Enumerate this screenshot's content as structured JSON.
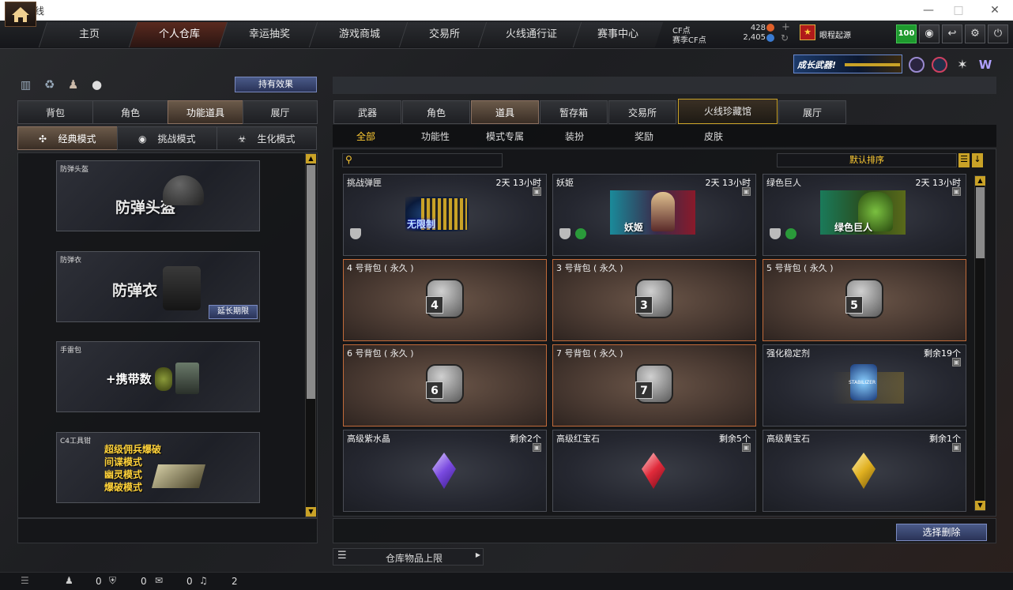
{
  "window": {
    "title": "穿越火线"
  },
  "nav": {
    "tabs": [
      "主页",
      "个人仓库",
      "幸运抽奖",
      "游戏商城",
      "交易所",
      "火线通行证",
      "赛事中心"
    ],
    "cf_label": "CF点",
    "cf_value": "428",
    "match_cf_label": "赛季CF点",
    "match_cf_value": "2,405",
    "rank_name": "眼程起源",
    "level_badge": "100"
  },
  "banner": {
    "text": "成长武器!"
  },
  "left": {
    "effect_button": "持有效果",
    "tabs": [
      "背包",
      "角色",
      "功能道具",
      "展厅"
    ],
    "mode_tabs": [
      "经典模式",
      "挑战模式",
      "生化模式"
    ],
    "cards": [
      {
        "name": "防弹头盔",
        "art_text": "防弹头盔"
      },
      {
        "name": "防弹衣",
        "art_text": "防弹衣",
        "extend": "延长期限"
      },
      {
        "name": "手雷包",
        "art_text": "+携带数"
      },
      {
        "name": "C4工具钳",
        "art_lines": [
          "超级佣兵爆破",
          "间谍模式",
          "幽灵模式",
          "爆破模式"
        ]
      }
    ]
  },
  "right": {
    "tabs": [
      "武器",
      "角色",
      "道具",
      "暂存箱",
      "交易所",
      "火线珍藏馆",
      "展厅"
    ],
    "subtabs": [
      "全部",
      "功能性",
      "模式专属",
      "装扮",
      "奖励",
      "皮肤"
    ],
    "search_placeholder": "",
    "sort_label": "默认排序",
    "items": [
      {
        "name": "挑战弹匣",
        "right": "2天 13小时",
        "art": "无限制"
      },
      {
        "name": "妖姬",
        "right": "2天 13小时",
        "art": "妖姬"
      },
      {
        "name": "绿色巨人",
        "right": "2天 13小时",
        "art": "绿色巨人"
      },
      {
        "name": "4 号背包 ( 永久 )",
        "right": "",
        "art": "4"
      },
      {
        "name": "3 号背包 ( 永久 )",
        "right": "",
        "art": "3"
      },
      {
        "name": "5 号背包 ( 永久 )",
        "right": "",
        "art": "5"
      },
      {
        "name": "6 号背包 ( 永久 )",
        "right": "",
        "art": "6"
      },
      {
        "name": "7 号背包 ( 永久 )",
        "right": "",
        "art": "7"
      },
      {
        "name": "强化稳定剂",
        "right": "剩余19个",
        "art": "STABILIZER"
      },
      {
        "name": "高级紫水晶",
        "right": "剩余2个",
        "art": ""
      },
      {
        "name": "高级红宝石",
        "right": "剩余5个",
        "art": ""
      },
      {
        "name": "高级黄宝石",
        "right": "剩余1个",
        "art": ""
      }
    ],
    "delete_button": "选择删除",
    "storage_label": "仓库物品上限"
  },
  "status": {
    "friends": "0",
    "shield": "0",
    "chat": "0",
    "voice": "2"
  },
  "colors": {
    "accent": "#ffcc33",
    "bag_border": "#c26b3a",
    "purple": "#9b6bff",
    "red": "#ff3344",
    "yellow": "#f0c020"
  }
}
